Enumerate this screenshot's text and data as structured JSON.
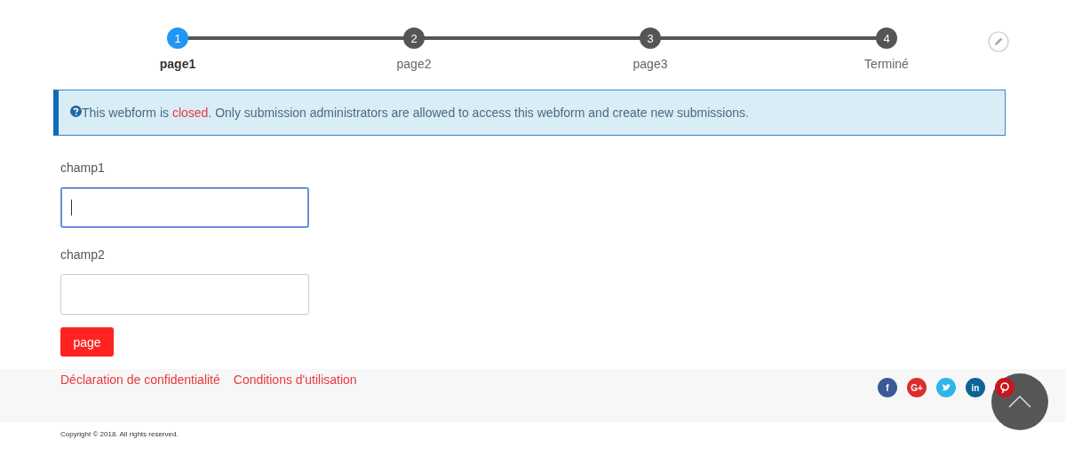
{
  "steps": [
    {
      "number": "1",
      "label": "page1",
      "selected": true
    },
    {
      "number": "2",
      "label": "page2",
      "selected": false
    },
    {
      "number": "3",
      "label": "page3",
      "selected": false
    },
    {
      "number": "4",
      "label": "Terminé",
      "selected": false
    }
  ],
  "alert": {
    "parts": [
      {
        "text": "This webform is ",
        "kind": "plain"
      },
      {
        "text": "closed",
        "kind": "highlight"
      },
      {
        "text": ". Only submission administrators are allowed to access this webform and create new submissions.",
        "kind": "plain"
      }
    ]
  },
  "fields": [
    {
      "label": "champ1",
      "focused": true
    },
    {
      "label": "champ2",
      "focused": false
    }
  ],
  "submit_button": "page",
  "footer_links": [
    "Déclaration de confidentialité",
    "Conditions d'utilisation"
  ],
  "social": [
    {
      "kind": "letter",
      "glyph": "f",
      "color": "#3b5998"
    },
    {
      "kind": "letter",
      "glyph": "G+",
      "color": "#dd2c2c"
    },
    {
      "kind": "bird",
      "color": "#2fb5ea"
    },
    {
      "kind": "letter",
      "glyph": "in",
      "color": "#0b6594"
    },
    {
      "kind": "pin",
      "color": "#c8161d"
    }
  ],
  "copyright": "Copyright © 2018. All rights reserved."
}
